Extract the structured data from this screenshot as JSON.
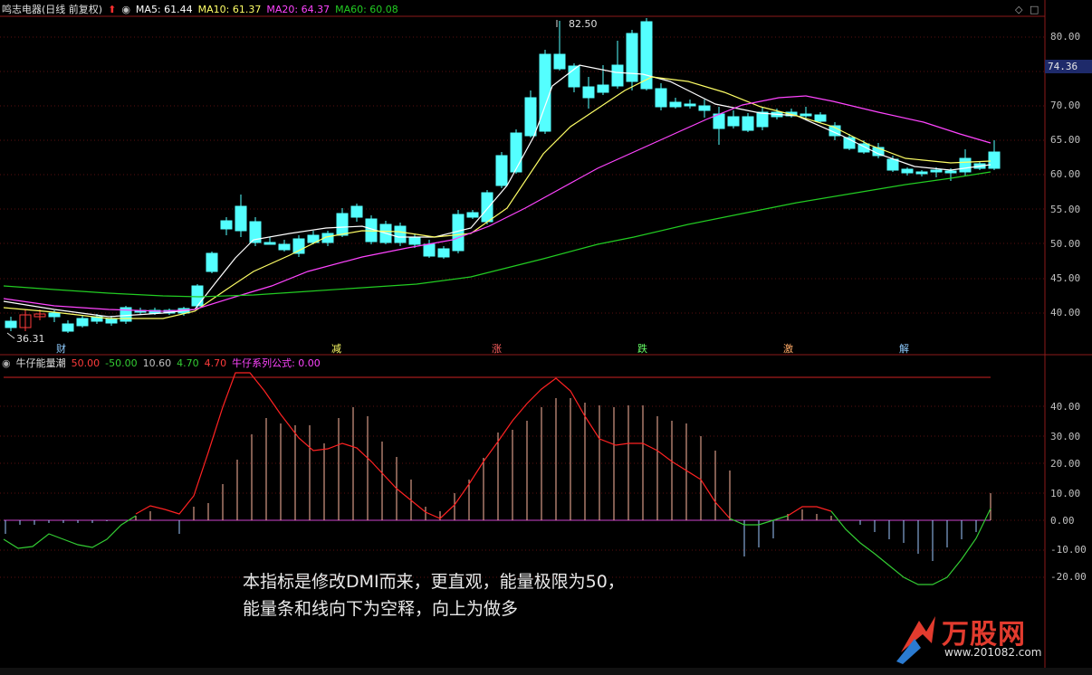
{
  "stock": {
    "title": "鸣志电器(日线 前复权)",
    "ma5": "MA5: 61.44",
    "ma10": "MA10: 61.37",
    "ma20": "MA20: 64.37",
    "ma60": "MA60: 60.08",
    "high_label": "82.50",
    "low_label": "36.31",
    "current_price": "74.36",
    "y_ticks": [
      "80.00",
      "75.00",
      "70.00",
      "65.00",
      "60.00",
      "55.00",
      "50.00",
      "45.00",
      "40.00"
    ]
  },
  "events": [
    "财",
    "减",
    "涨",
    "跌",
    "激",
    "解"
  ],
  "indicator": {
    "name": "牛仔能量潮",
    "v1": "50.00",
    "v2": "-50.00",
    "v3": "10.60",
    "v4": "4.70",
    "v5": "4.70",
    "formula": "牛仔系列公式: 0.00",
    "y_ticks": [
      "40.00",
      "30.00",
      "20.00",
      "10.00",
      "0.00",
      "-10.00",
      "-20.00"
    ]
  },
  "note": {
    "line1": "本指标是修改DMI而来，更直观，能量极限为50，",
    "line2": "能量条和线向下为空释，向上为做多"
  },
  "logo": {
    "main": "万股网",
    "sub": "www.201082.com"
  },
  "colors": {
    "ma5": "#ffffff",
    "ma10": "#ffff66",
    "ma20": "#ff44ff",
    "ma60": "#22cc22",
    "up": "#ff3b3b",
    "down": "#54ffff",
    "energy_line": "#ff2222",
    "neg_line": "#33cc33"
  }
}
